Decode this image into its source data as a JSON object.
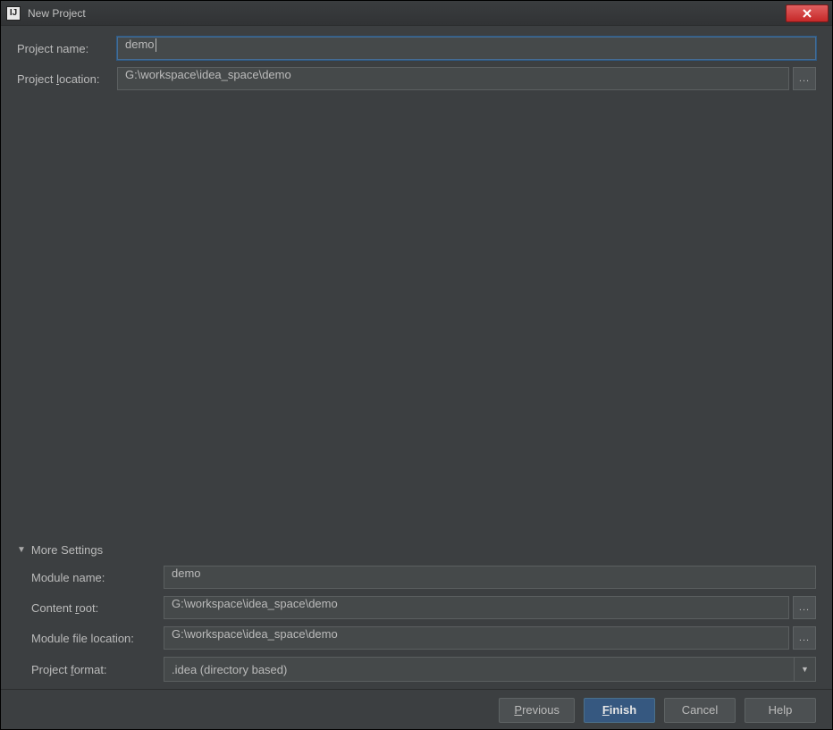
{
  "window": {
    "title": "New Project"
  },
  "form": {
    "project_name_label": "Project name:",
    "project_name_value": "demo",
    "project_location_label_pre": "Project ",
    "project_location_label_mn": "l",
    "project_location_label_post": "ocation:",
    "project_location_value": "G:\\workspace\\idea_space\\demo",
    "browse_label": "..."
  },
  "more": {
    "header": "More Settings",
    "module_name_label": "Module name:",
    "module_name_value": "demo",
    "content_root_label_pre": "Content ",
    "content_root_label_mn": "r",
    "content_root_label_post": "oot:",
    "content_root_value": "G:\\workspace\\idea_space\\demo",
    "module_file_loc_label": "Module file location:",
    "module_file_loc_value": "G:\\workspace\\idea_space\\demo",
    "project_format_label_pre": "Project ",
    "project_format_label_mn": "f",
    "project_format_label_post": "ormat:",
    "project_format_value": ".idea (directory based)"
  },
  "buttons": {
    "previous_mn": "P",
    "previous_rest": "revious",
    "finish_mn": "F",
    "finish_rest": "inish",
    "cancel": "Cancel",
    "help": "Help"
  }
}
